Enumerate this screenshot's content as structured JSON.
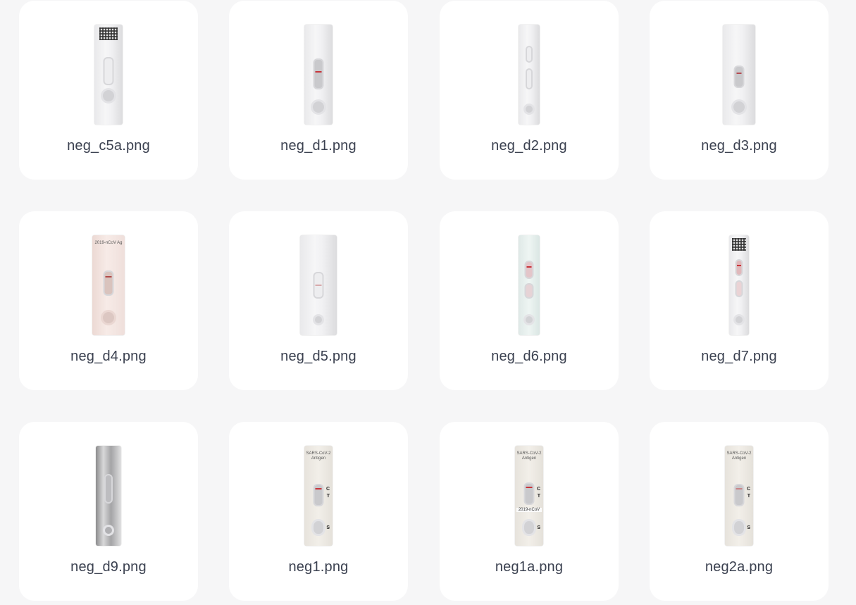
{
  "files": [
    {
      "name": "neg_c5a.png"
    },
    {
      "name": "neg_d1.png"
    },
    {
      "name": "neg_d2.png"
    },
    {
      "name": "neg_d3.png"
    },
    {
      "name": "neg_d4.png"
    },
    {
      "name": "neg_d5.png"
    },
    {
      "name": "neg_d6.png"
    },
    {
      "name": "neg_d7.png"
    },
    {
      "name": "neg_d9.png"
    },
    {
      "name": "neg1.png"
    },
    {
      "name": "neg1a.png"
    },
    {
      "name": "neg2a.png"
    }
  ],
  "printed_text": {
    "d4_header": "2019-nCoV Ag",
    "sars_header": "SARS-CoV-2 Antigen",
    "neg1a_band": "2019-nCoV",
    "c_mark": "C",
    "t_mark": "T",
    "s_mark": "S"
  }
}
